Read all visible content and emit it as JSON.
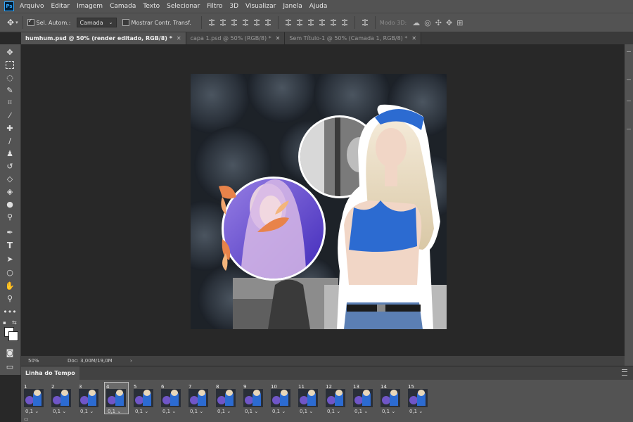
{
  "app": {
    "logo_text": "Ps"
  },
  "menu": [
    "Arquivo",
    "Editar",
    "Imagem",
    "Camada",
    "Texto",
    "Selecionar",
    "Filtro",
    "3D",
    "Visualizar",
    "Janela",
    "Ajuda"
  ],
  "options": {
    "auto_select_label": "Sel. Autom.:",
    "auto_select_checked": true,
    "layer_dropdown": "Camada",
    "show_transform_label": "Mostrar Contr. Transf.",
    "show_transform_checked": false,
    "mode3d_label": "Modo 3D:"
  },
  "tabs": [
    {
      "label": "humhum.psd @ 50% (render editado, RGB/8) *",
      "active": true
    },
    {
      "label": "capa 1.psd @ 50% (RGB/8) *",
      "active": false
    },
    {
      "label": "Sem Título-1 @ 50% (Camada 1, RGB/8) *",
      "active": false
    }
  ],
  "tools": [
    "move-icon",
    "marquee-icon",
    "lasso-icon",
    "quick-select-icon",
    "crop-icon",
    "eyedropper-icon",
    "healing-brush-icon",
    "brush-icon",
    "clone-stamp-icon",
    "history-brush-icon",
    "eraser-icon",
    "paint-bucket-icon",
    "blur-icon",
    "dodge-icon",
    "pen-icon",
    "type-icon",
    "path-select-icon",
    "ellipse-icon",
    "hand-icon",
    "zoom-icon",
    "more-tools-icon"
  ],
  "status": {
    "zoom": "50%",
    "doc": "Doc: 3,00M/19,0M",
    "arrow": "›"
  },
  "timeline": {
    "title": "Linha do Tempo",
    "frames": [
      {
        "num": "1",
        "delay": "0,1"
      },
      {
        "num": "2",
        "delay": "0,1"
      },
      {
        "num": "3",
        "delay": "0,1"
      },
      {
        "num": "4",
        "delay": "0,1",
        "selected": true
      },
      {
        "num": "5",
        "delay": "0,1"
      },
      {
        "num": "6",
        "delay": "0,1"
      },
      {
        "num": "7",
        "delay": "0,1"
      },
      {
        "num": "8",
        "delay": "0,1"
      },
      {
        "num": "9",
        "delay": "0,1"
      },
      {
        "num": "10",
        "delay": "0,1"
      },
      {
        "num": "11",
        "delay": "0,1"
      },
      {
        "num": "12",
        "delay": "0,1"
      },
      {
        "num": "13",
        "delay": "0,1"
      },
      {
        "num": "14",
        "delay": "0,1"
      },
      {
        "num": "15",
        "delay": "0,1"
      }
    ]
  },
  "colors": {
    "accent": "#31a8ff",
    "top_blue": "#2c6bd1",
    "circle_purple": "#6a4fd0"
  }
}
